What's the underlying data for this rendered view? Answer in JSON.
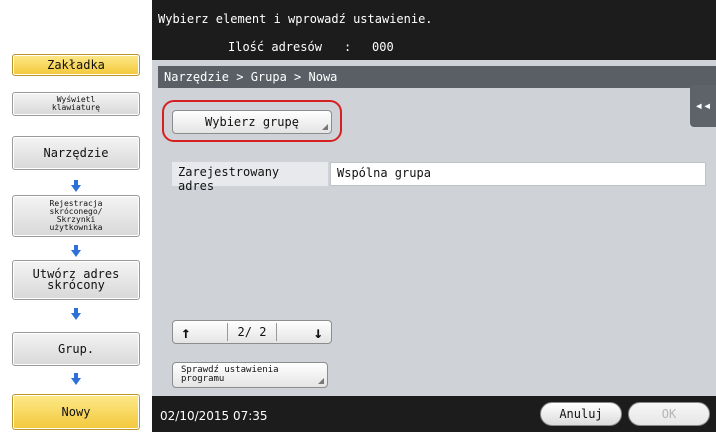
{
  "header": {
    "instruction": "Wybierz element i wprowadź ustawienie.",
    "address_count_label": "Ilość adresów",
    "address_count_sep": ":",
    "address_count_value": "000"
  },
  "sidebar": {
    "tab_label": "Zakładka",
    "keyboard_label": "Wyświetl klawiaturę",
    "steps": [
      {
        "label": "Narzędzie"
      },
      {
        "label": "Rejestracja skróconego/ Skrzynki użytkownika"
      },
      {
        "label": "Utwórz adres skrócony"
      },
      {
        "label": "Grup."
      },
      {
        "label": "Nowy"
      }
    ]
  },
  "main": {
    "breadcrumb": "Narzędzie > Grupa > Nowa",
    "select_group_button": "Wybierz grupę",
    "registered_address_label": "Zarejestrowany adres",
    "registered_address_value": "Wspólna grupa",
    "page_indicator": "2/ 2",
    "check_settings_button": "Sprawdź ustawienia programu",
    "collapse_glyph": "◂◂"
  },
  "footer": {
    "datetime": "02/10/2015  07:35",
    "cancel_label": "Anuluj",
    "ok_label": "OK"
  },
  "colors": {
    "highlight_ring": "#d62020",
    "step_arrow": "#2e6fd8",
    "active_step": "#f3c83a"
  }
}
